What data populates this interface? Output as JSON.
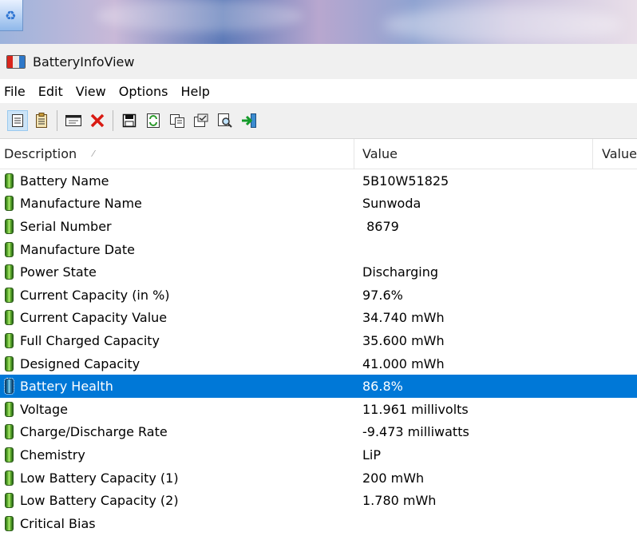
{
  "window": {
    "title": "BatteryInfoView"
  },
  "menu": [
    "File",
    "Edit",
    "View",
    "Options",
    "Help"
  ],
  "toolbar": {
    "buttons": [
      {
        "icon": "page-icon",
        "glyph": "🗏"
      },
      {
        "icon": "page-list-icon",
        "glyph": "🗒"
      },
      {
        "icon": "window-icon",
        "glyph": "🗔"
      },
      {
        "icon": "delete-icon",
        "glyph": "✕"
      },
      {
        "icon": "save-icon",
        "glyph": "🖫"
      },
      {
        "icon": "refresh-icon",
        "glyph": "⟳"
      },
      {
        "icon": "copy-icon",
        "glyph": "⎘"
      },
      {
        "icon": "properties-icon",
        "glyph": "☑"
      },
      {
        "icon": "find-icon",
        "glyph": "🔍"
      },
      {
        "icon": "exit-icon",
        "glyph": "⇥"
      }
    ]
  },
  "table": {
    "columns": [
      "Description",
      "Value",
      "Value"
    ],
    "rows": [
      {
        "description": "Battery Name",
        "value": "5B10W51825"
      },
      {
        "description": "Manufacture Name",
        "value": "Sunwoda"
      },
      {
        "description": "Serial Number",
        "value": " 8679"
      },
      {
        "description": "Manufacture Date",
        "value": ""
      },
      {
        "description": "Power State",
        "value": "Discharging"
      },
      {
        "description": "Current Capacity (in %)",
        "value": "97.6%"
      },
      {
        "description": "Current Capacity Value",
        "value": "34.740 mWh"
      },
      {
        "description": "Full Charged Capacity",
        "value": "35.600 mWh"
      },
      {
        "description": "Designed Capacity",
        "value": "41.000 mWh"
      },
      {
        "description": "Battery Health",
        "value": "86.8%",
        "selected": true
      },
      {
        "description": "Voltage",
        "value": "11.961 millivolts"
      },
      {
        "description": "Charge/Discharge Rate",
        "value": "-9.473 milliwatts"
      },
      {
        "description": "Chemistry",
        "value": "LiP"
      },
      {
        "description": "Low Battery Capacity (1)",
        "value": "200 mWh"
      },
      {
        "description": "Low Battery Capacity (2)",
        "value": "1.780 mWh"
      },
      {
        "description": "Critical Bias",
        "value": ""
      }
    ]
  },
  "colors": {
    "selection": "#0078d7",
    "toolbar_bg": "#f0f0f0"
  }
}
